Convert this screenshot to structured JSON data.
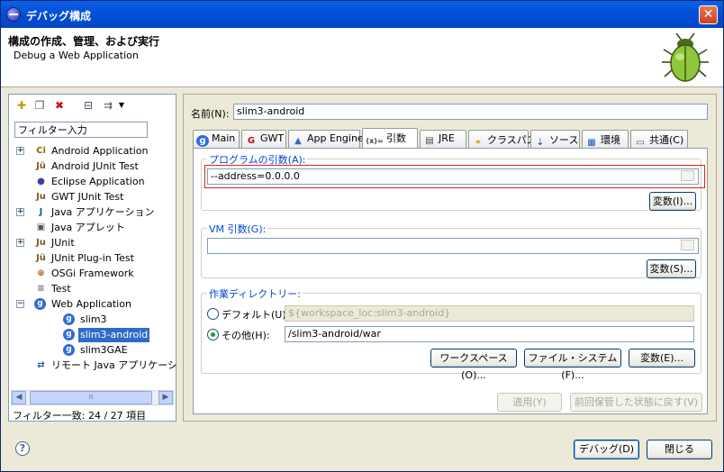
{
  "window": {
    "title": "デバッグ構成",
    "close": "✕"
  },
  "header": {
    "title": "構成の作成、管理、および実行",
    "subtitle": "Debug a Web Application"
  },
  "left": {
    "filter_value": "フィルター入力",
    "tree": [
      {
        "label": "Android Application",
        "icon": "android-icon",
        "glyph": "Ci",
        "expand": "+"
      },
      {
        "label": "Android JUnit Test",
        "icon": "junit-icon",
        "glyph": "Jü"
      },
      {
        "label": "Eclipse Application",
        "icon": "eclipse-icon",
        "glyph": "●"
      },
      {
        "label": "GWT JUnit Test",
        "icon": "junit-icon",
        "glyph": "Ju"
      },
      {
        "label": "Java アプリケーション",
        "icon": "java-app-icon",
        "glyph": "J",
        "expand": "+"
      },
      {
        "label": "Java アプレット",
        "icon": "applet-icon",
        "glyph": "▣"
      },
      {
        "label": "JUnit",
        "icon": "junit-icon",
        "glyph": "Ju",
        "expand": "+"
      },
      {
        "label": "JUnit Plug-in Test",
        "icon": "junit-icon",
        "glyph": "Jü"
      },
      {
        "label": "OSGi Framework",
        "icon": "osgi-icon",
        "glyph": "⊕"
      },
      {
        "label": "Test",
        "icon": "test-icon",
        "glyph": "≡"
      },
      {
        "label": "Web Application",
        "icon": "gae-icon",
        "glyph": "g",
        "expand": "−"
      },
      {
        "label": "slim3",
        "icon": "gae-icon",
        "glyph": "g",
        "child": true
      },
      {
        "label": "slim3-android",
        "icon": "gae-icon",
        "glyph": "g",
        "child": true,
        "selected": true
      },
      {
        "label": "slim3GAE",
        "icon": "gae-icon",
        "glyph": "g",
        "child": true
      },
      {
        "label": "リモート Java アプリケーション",
        "icon": "remote-java-icon",
        "glyph": "⇄"
      }
    ],
    "scroll_thumb": "Ⅲ",
    "filter_count": "フィルター一致: 24 / 27 項目"
  },
  "right": {
    "name_label": "名前(N):",
    "name_value": "slim3-android",
    "tabs": [
      {
        "label": "Main",
        "icon": "gae-icon",
        "glyph": "g"
      },
      {
        "label": "GWT",
        "icon": "gwt-icon",
        "glyph": "G"
      },
      {
        "label": "App Engine",
        "icon": "appengine-icon",
        "glyph": "▲"
      },
      {
        "label": "引数",
        "icon": "arguments-icon",
        "glyph": "(x)="
      },
      {
        "label": "JRE",
        "icon": "jre-icon",
        "glyph": "▤"
      },
      {
        "label": "クラスパス",
        "icon": "classpath-icon",
        "glyph": "⚭"
      },
      {
        "label": "ソース",
        "icon": "source-icon",
        "glyph": "⇣"
      },
      {
        "label": "環境",
        "icon": "environment-icon",
        "glyph": "▦"
      },
      {
        "label": "共通(C)",
        "icon": "common-icon",
        "glyph": "▭"
      }
    ],
    "program_args": {
      "label": "プログラムの引数(A):",
      "value": "--address=0.0.0.0",
      "variables": "変数(I)..."
    },
    "vm_args": {
      "label": "VM 引数(G):",
      "value": "",
      "variables": "変数(S)..."
    },
    "workdir": {
      "label": "作業ディレクトリー:",
      "default_label": "デフォルト(U):",
      "default_value": "${workspace_loc:slim3-android}",
      "other_label": "その他(H):",
      "other_value": "/slim3-android/war",
      "workspace_btn": "ワークスペース(O)...",
      "filesystem_btn": "ファイル・システム(F)...",
      "variables_btn": "変数(E)..."
    },
    "apply": "適用(Y)",
    "revert": "前回保管した状態に戻す(V)"
  },
  "footer": {
    "help": "?",
    "debug": "デバッグ(D)",
    "close": "閉じる"
  },
  "colors": {
    "title_bar": "#0450d8",
    "selection": "#316ac5",
    "highlight_border": "#e02020"
  }
}
